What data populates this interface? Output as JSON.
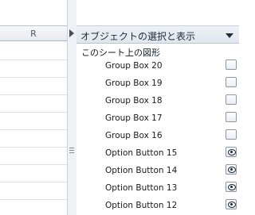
{
  "sheet": {
    "column_header": "R"
  },
  "selection_pane": {
    "title": "オブジェクトの選択と表示",
    "section_label": "このシート上の図形",
    "shapes": [
      {
        "label": "Group Box 20",
        "icon": "box-icon"
      },
      {
        "label": "Group Box 19",
        "icon": "box-icon"
      },
      {
        "label": "Group Box 18",
        "icon": "box-icon"
      },
      {
        "label": "Group Box 17",
        "icon": "box-icon"
      },
      {
        "label": "Group Box 16",
        "icon": "box-icon"
      },
      {
        "label": "Option Button 15",
        "icon": "eye-icon"
      },
      {
        "label": "Option Button 14",
        "icon": "eye-icon"
      },
      {
        "label": "Option Button 13",
        "icon": "eye-icon"
      },
      {
        "label": "Option Button 12",
        "icon": "eye-icon"
      }
    ]
  }
}
